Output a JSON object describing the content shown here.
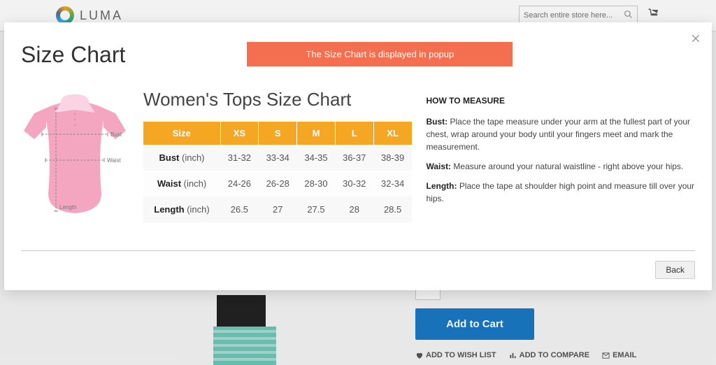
{
  "header": {
    "logo_text": "LUMA",
    "search_placeholder": "Search entire store here..."
  },
  "modal": {
    "title": "Size Chart",
    "banner": "The Size Chart is displayed in popup",
    "chart_title": "Women's Tops Size Chart",
    "back_label": "Back",
    "table": {
      "headers": [
        "Size",
        "XS",
        "S",
        "M",
        "L",
        "XL"
      ],
      "rows": [
        {
          "label": "Bust",
          "unit": "(inch)",
          "values": [
            "31-32",
            "33-34",
            "34-35",
            "36-37",
            "38-39"
          ]
        },
        {
          "label": "Waist",
          "unit": "(inch)",
          "values": [
            "24-26",
            "26-28",
            "28-30",
            "30-32",
            "32-34"
          ]
        },
        {
          "label": "Length",
          "unit": "(inch)",
          "values": [
            "26.5",
            "27",
            "27.5",
            "28",
            "28.5"
          ]
        }
      ]
    },
    "diagram": {
      "bust": "Bust",
      "waist": "Waist",
      "length": "Length"
    },
    "measure": {
      "title": "HOW TO MEASURE",
      "items": [
        {
          "label": "Bust:",
          "text": " Place the tape measure under your arm at the fullest part of your chest, wrap around your body until your fingers meet and mark the measurement."
        },
        {
          "label": "Waist:",
          "text": " Measure around your natural waistline - right above your hips."
        },
        {
          "label": "Length:",
          "text": " Place the tape at shoulder high point and measure till over your hips."
        }
      ]
    }
  },
  "product": {
    "add_to_cart": "Add to Cart",
    "wishlist": "ADD TO WISH LIST",
    "compare": "ADD TO COMPARE",
    "email": "EMAIL"
  }
}
